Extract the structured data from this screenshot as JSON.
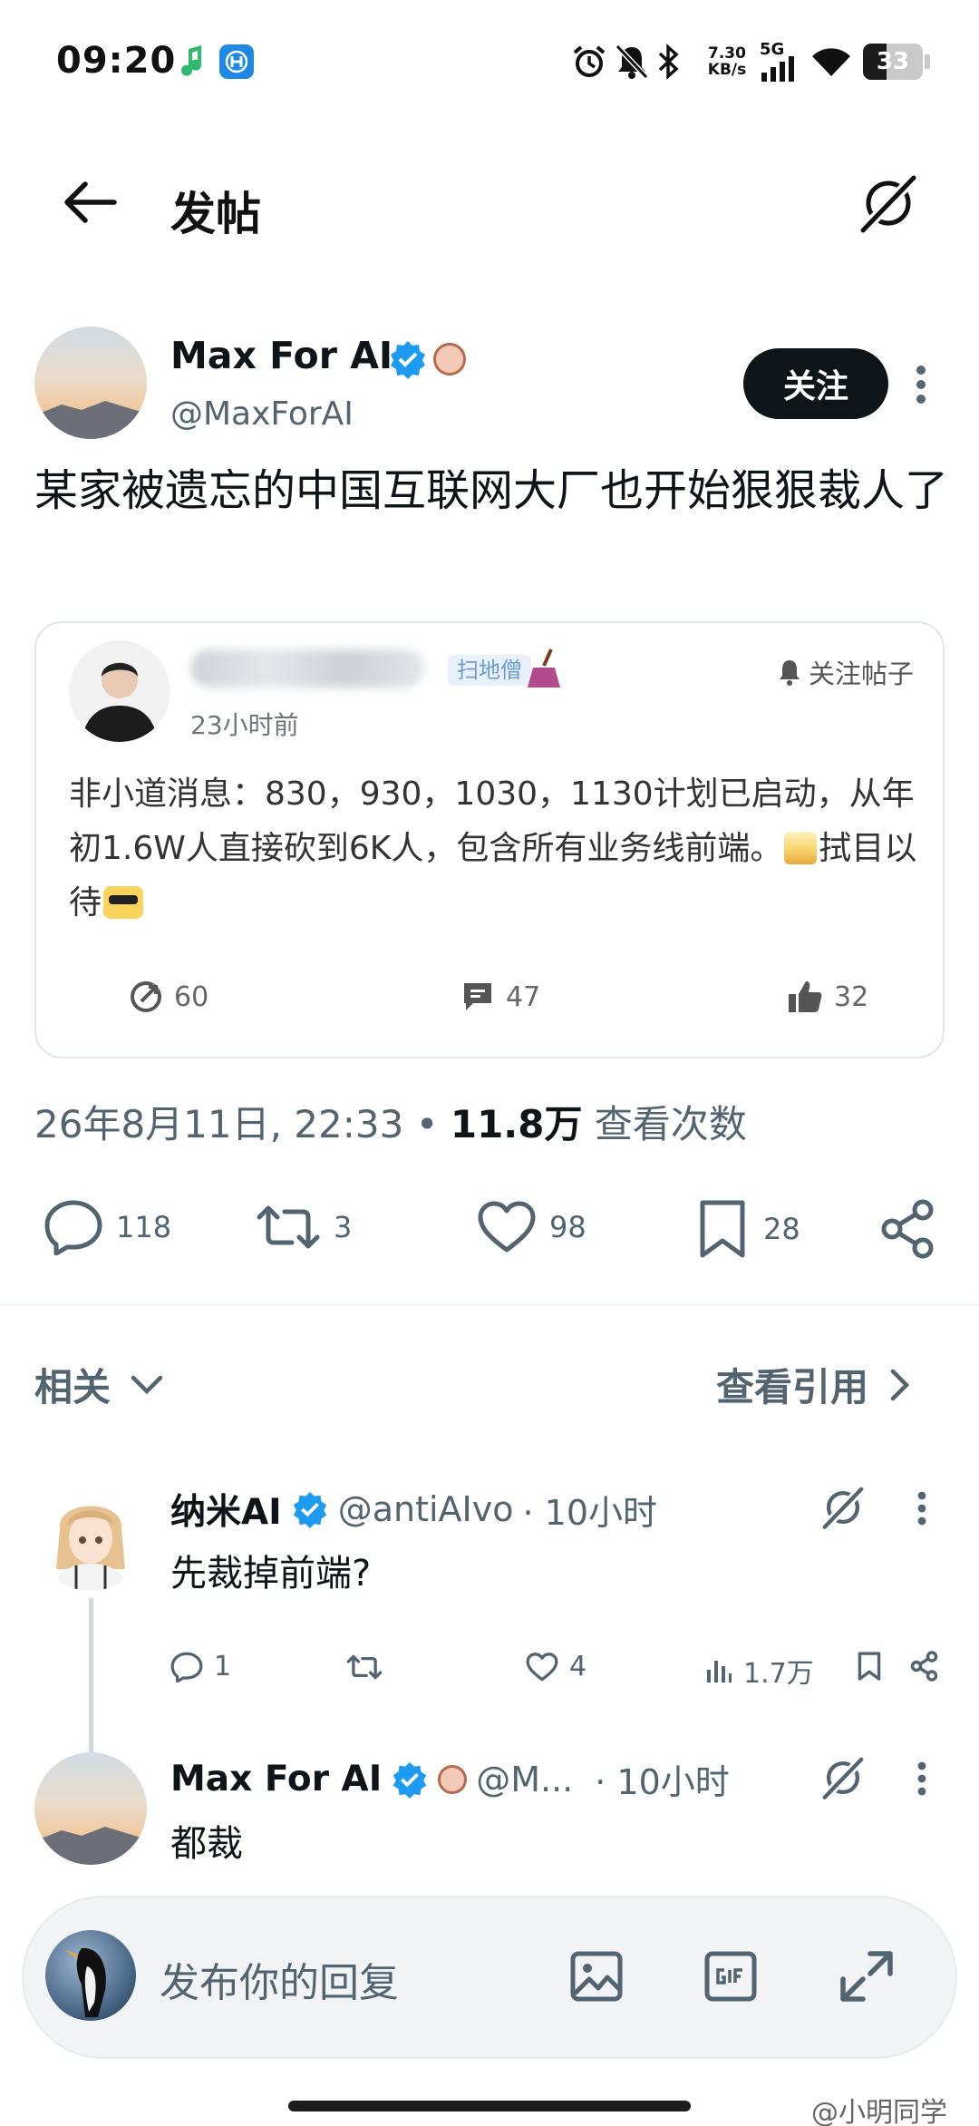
{
  "status_bar": {
    "time": "09:20",
    "net_speed_value": "7.30",
    "net_speed_unit": "KB/s",
    "network": "5G",
    "battery": "33"
  },
  "header": {
    "title": "发帖"
  },
  "post": {
    "author_name": "Max For AI",
    "author_handle": "@MaxForAI",
    "follow_label": "关注",
    "text": "某家被遗忘的中国互联网大厂也开始狠狠裁人了",
    "timestamp": "26年8月11日, 22:33",
    "separator": "•",
    "views_count": "11.8万",
    "views_label": "查看次数",
    "stats": {
      "replies": "118",
      "reposts": "3",
      "likes": "98",
      "bookmarks": "28"
    }
  },
  "quoted_card": {
    "badge": "扫地僧",
    "time": "23小时前",
    "follow_label": "关注帖子",
    "text": "非小道消息：830，930，1030，1130计划已启动，从年初1.6W人直接砍到6K人，包含所有业务线前端。",
    "text_tail": "拭目以待",
    "stats": {
      "shares": "60",
      "comments": "47",
      "likes": "32"
    }
  },
  "section": {
    "related_label": "相关",
    "quotes_label": "查看引用"
  },
  "replies": [
    {
      "name": "纳米AI",
      "handle": "@antiAIvo",
      "time": "· 10小时",
      "text": "先裁掉前端?",
      "stats": {
        "replies": "1",
        "likes": "4",
        "views": "1.7万"
      }
    },
    {
      "name": "Max For AI",
      "handle": "@M...",
      "time": "· 10小时",
      "text": "都裁"
    }
  ],
  "composer": {
    "placeholder": "发布你的回复"
  },
  "watermark": "@小明同学"
}
